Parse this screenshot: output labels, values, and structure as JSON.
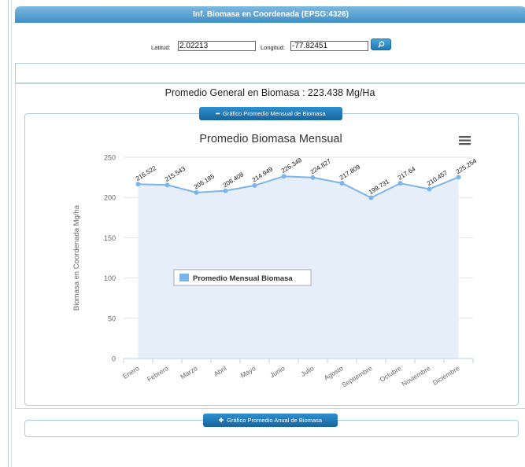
{
  "panel": {
    "title": "Inf. Biomasa en Coordenada (EPSG:4326)"
  },
  "coords": {
    "lat_label": "Latitud:",
    "lat_value": "2.02213",
    "lon_label": "Longitud:",
    "lon_value": "-77.82451",
    "search_icon": "search-icon"
  },
  "summary": {
    "text": "Promedio General en Biomasa : 223.438 Mg/Ha"
  },
  "monthly_section": {
    "button_label": "Gráfico Promedio Mensual de Biomasa",
    "icon": "minus-icon"
  },
  "annual_section": {
    "button_label": "Gráfico Promedio Anual de Biomasa",
    "icon": "plus-icon"
  },
  "chart_menu_icon": "hamburger-menu-icon",
  "colors": {
    "series": "#7cb5ec",
    "area": "#e6eef9",
    "accent": "#1f78b4"
  },
  "chart_data": {
    "type": "area",
    "title": "Promedio Biomasa Mensual",
    "ylabel": "Biomasa en Coordenada Mg/ha",
    "xlabel": "",
    "ylim": [
      0,
      250
    ],
    "yticks": [
      0,
      50,
      100,
      150,
      200,
      250
    ],
    "legend": "left-center",
    "grid": true,
    "categories": [
      "Enero",
      "Febrero",
      "Marzo",
      "Abril",
      "Mayo",
      "Junio",
      "Julio",
      "Agosto",
      "Septiembre",
      "Octubre",
      "Noviembre",
      "Diciembre"
    ],
    "series": [
      {
        "name": "Promedio Mensual Biomasa",
        "values": [
          216.522,
          215.543,
          206.185,
          208.408,
          214.949,
          226.348,
          224.827,
          217.809,
          199.731,
          217.64,
          210.457,
          225.254
        ],
        "labels": [
          "216.522",
          "215.543",
          "206.185",
          "208.408",
          "214.949",
          "226.348",
          "224.827",
          "217.809",
          "199.731",
          "217.64",
          "210.457",
          "225.254"
        ]
      }
    ]
  }
}
